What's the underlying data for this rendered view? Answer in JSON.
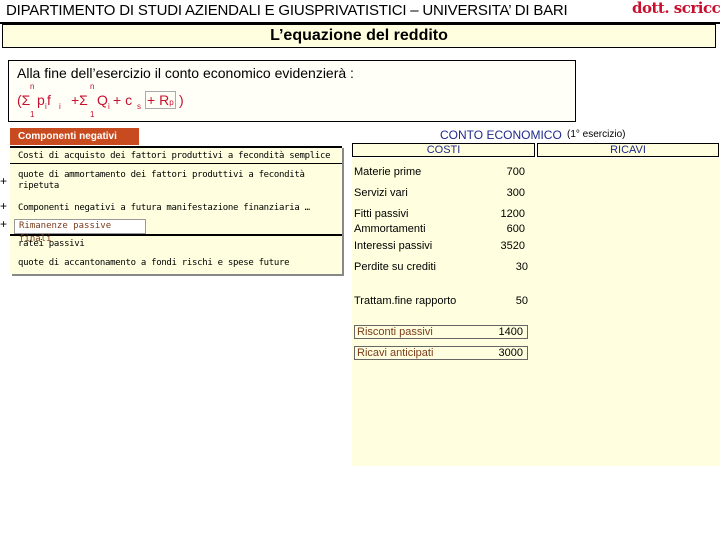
{
  "header": {
    "title": "DIPARTIMENTO DI STUDI AZIENDALI E GIUSPRIVATISTICI – UNIVERSITA’ DI BARI",
    "author": "dott. scricco"
  },
  "slide_title": "L’equazione del reddito",
  "formula_box": {
    "intro": "Alla fine dell’esercizio il conto economico evidenzierà :",
    "upper_index": "n",
    "lower_index": "1",
    "open": "(Σ",
    "term1": "p",
    "term1_sub": "i",
    "term1b": " f",
    "term1b_sub": "i",
    "plus_sigma": "+Σ",
    "term2": "Q",
    "term2_sub": "i",
    "plus_c": "+ c",
    "c_sub": "s",
    "plus_r": "+ R",
    "r_sub": "p",
    "close": ")"
  },
  "left_panel": {
    "label": "Componenti negativi",
    "row1": "Costi di acquisto dei fattori produttivi a fecondità semplice",
    "row2": "quote di ammortamento dei fattori produttivi a fecondità ripetuta",
    "row3": "Componenti negativi a futura manifestazione finanziaria …",
    "rimanenze": "Rimanenze passive finali",
    "row5": "ratei passivi",
    "row6": "quote di accantonamento a fondi rischi e spese future",
    "plus": "+"
  },
  "income_statement": {
    "title": "CONTO ECONOMICO",
    "subtitle": "(1° esercizio)",
    "costs_header": "COSTI",
    "revenues_header": "RICAVI",
    "items": [
      {
        "label": "Materie prime",
        "value": "700"
      },
      {
        "label": "Servizi vari",
        "value": "300"
      },
      {
        "label": "Fitti passivi",
        "value": "1200"
      },
      {
        "label": "Ammortamenti",
        "value": "600"
      },
      {
        "label": "Interessi passivi",
        "value": "3520"
      },
      {
        "label": "Perdite su crediti",
        "value": "30"
      },
      {
        "label": "Trattam.fine rapporto",
        "value": "50"
      }
    ],
    "boxed_items": [
      {
        "label": "Risconti passivi",
        "value": "1400"
      },
      {
        "label": "Ricavi anticipati",
        "value": "3000"
      }
    ]
  },
  "colors": {
    "accent_red": "#c8102e",
    "label_bg": "#c84b1f",
    "panel_bg": "#ffffe0",
    "title_blue": "#1f2a8c"
  }
}
